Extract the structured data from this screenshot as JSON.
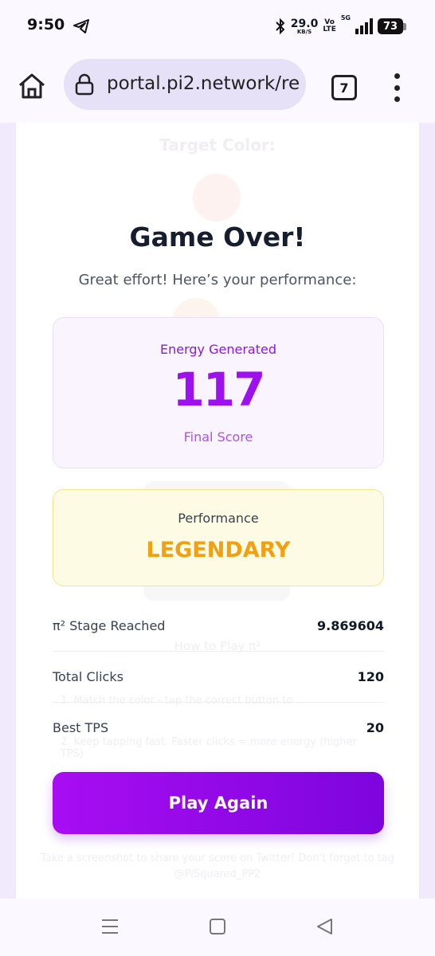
{
  "status_bar": {
    "time": "9:50",
    "net_speed": "29.0",
    "net_unit": "KB/S",
    "volte_top": "Vo",
    "volte_bottom": "LTE",
    "network": "5G",
    "battery": "73"
  },
  "browser": {
    "url": "portal.pi2.network/re",
    "tab_count": "7"
  },
  "background": {
    "target_label": "Target Color:",
    "how_to_play": "How to Play π²",
    "line1": "1.  Match the color - tap the correct button to ...",
    "line2": "2.  Keep tapping fast. Faster clicks = more energy (higher TPS)",
    "footer": "Take a screenshot to share your score on Twitter! Don't forget to tag @PiSquared_PP2"
  },
  "result": {
    "title": "Game Over!",
    "subtitle": "Great effort! Here’s your performance:",
    "energy_label": "Energy Generated",
    "energy_value": "117",
    "energy_sub": "Final Score",
    "performance_label": "Performance",
    "performance_value": "LEGENDARY"
  },
  "stats": [
    {
      "label": "π² Stage Reached",
      "value": "9.869604"
    },
    {
      "label": "Total Clicks",
      "value": "120"
    },
    {
      "label": "Best TPS",
      "value": "20"
    }
  ],
  "play_again": "Play Again",
  "colors": {
    "accent": "#9d11ee",
    "gold": "#f0a012",
    "button_start": "#a80df2",
    "button_end": "#7d05dd"
  }
}
